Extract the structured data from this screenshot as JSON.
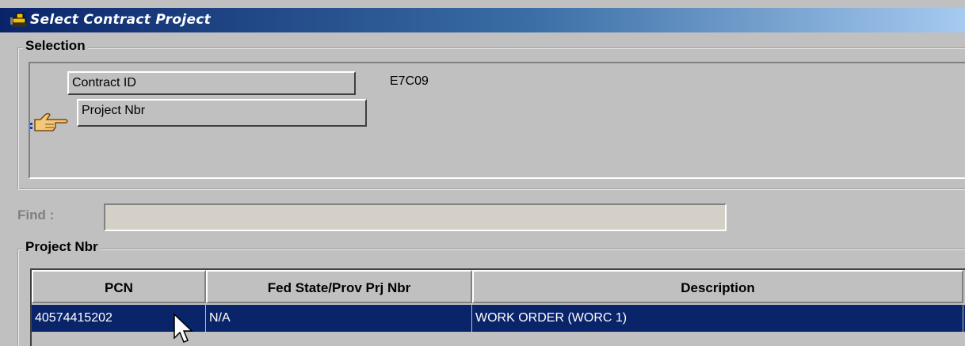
{
  "window": {
    "title": "Select Contract Project"
  },
  "selection": {
    "legend": "Selection",
    "contract_id_label": "Contract ID",
    "contract_id_value": "E7C09",
    "project_nbr_label": "Project Nbr"
  },
  "find": {
    "label": "Find :",
    "value": ""
  },
  "project_group": {
    "legend": "Project Nbr",
    "columns": [
      "PCN",
      "Fed State/Prov Prj Nbr",
      "Description"
    ],
    "rows": [
      {
        "pcn": "40574415202",
        "fed_nbr": "N/A",
        "description": "WORK ORDER (WORC 1)",
        "selected": true
      }
    ]
  },
  "colors": {
    "title_bar": "#0a246a",
    "selected_row": "#0a246a",
    "face": "#c0c0c0"
  },
  "icons": [
    "bulldozer-icon",
    "pointing-hand-icon",
    "mouse-cursor-icon"
  ]
}
